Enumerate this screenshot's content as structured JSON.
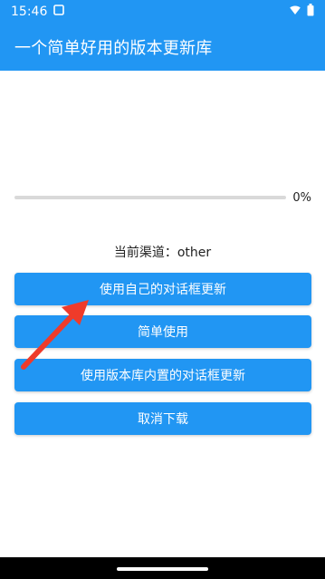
{
  "status_bar": {
    "time": "15:46"
  },
  "app_bar": {
    "title": "一个简单好用的版本更新库"
  },
  "progress": {
    "percent_label": "0%",
    "value": 0
  },
  "channel": {
    "label": "当前渠道：other"
  },
  "buttons": [
    {
      "label": "使用自己的对话框更新"
    },
    {
      "label": "简单使用"
    },
    {
      "label": "使用版本库内置的对话框更新"
    },
    {
      "label": "取消下载"
    }
  ],
  "colors": {
    "primary": "#2196f3",
    "annotation_arrow": "#ef3b2a"
  },
  "icons": {
    "status_left": [
      "screen-icon"
    ],
    "status_right": [
      "wifi-icon",
      "battery-icon"
    ]
  }
}
